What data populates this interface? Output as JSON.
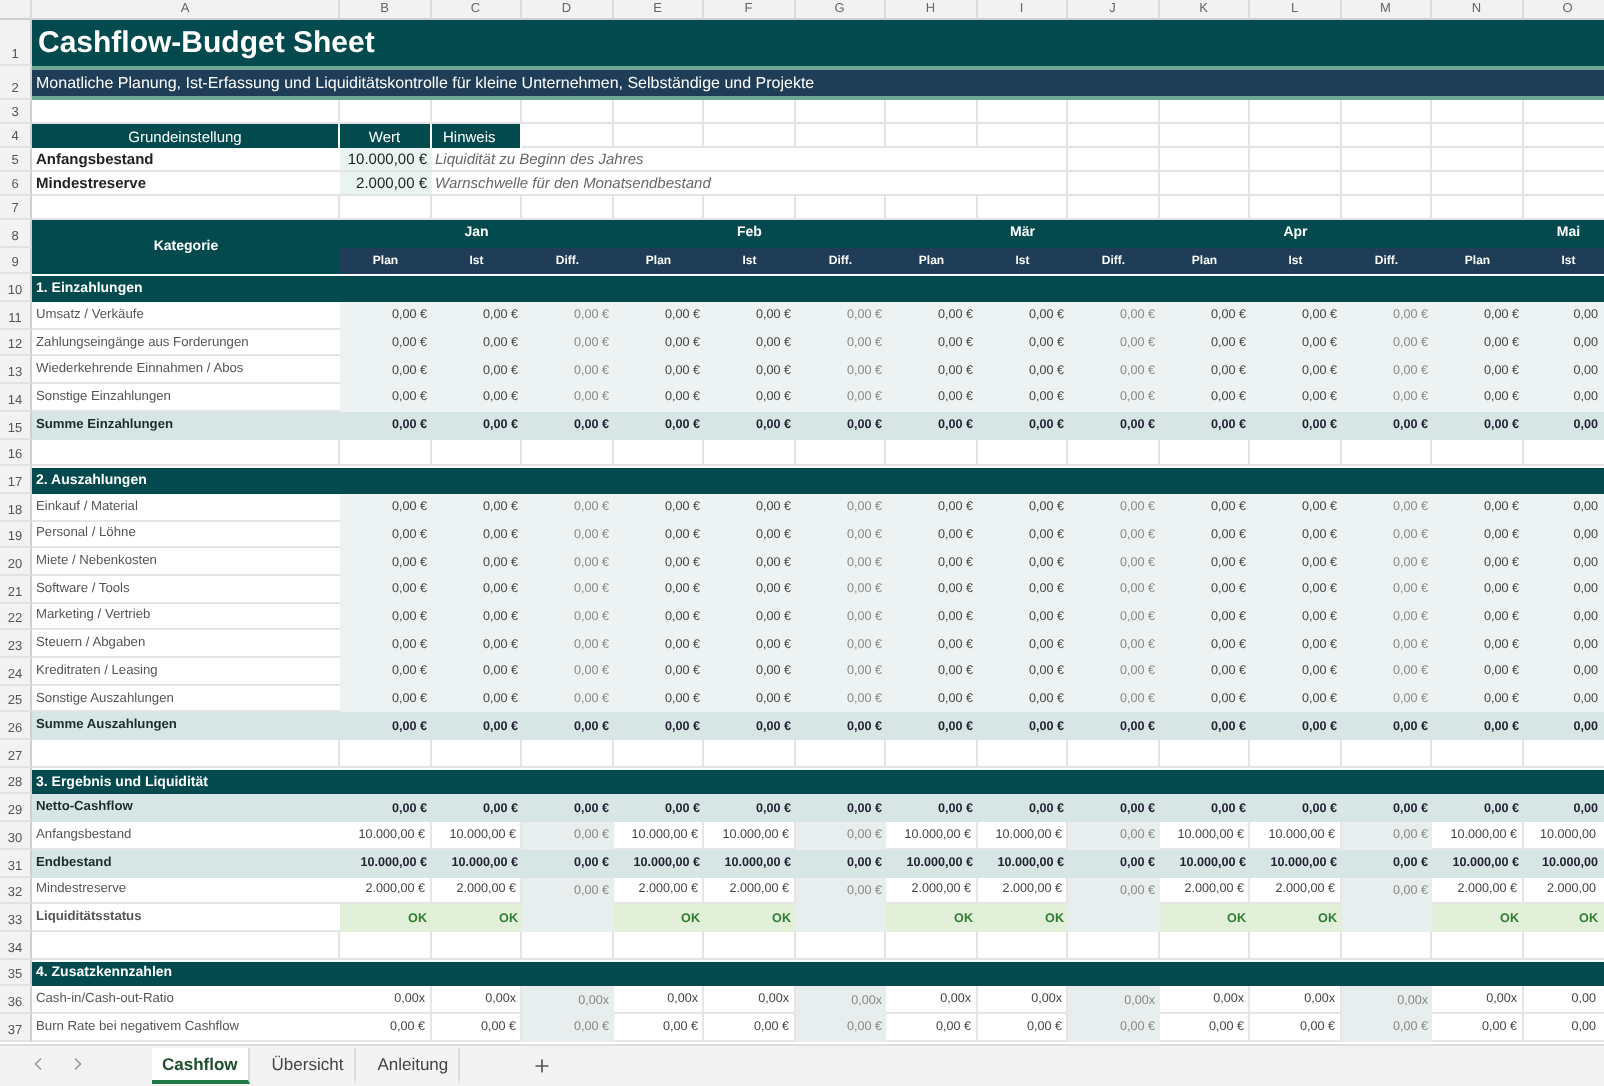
{
  "column_headers": [
    "A",
    "B",
    "C",
    "D",
    "E",
    "F",
    "G",
    "H",
    "I",
    "J",
    "K",
    "L",
    "M",
    "N",
    "O"
  ],
  "rows": [
    {
      "num": "1",
      "kind": "title",
      "text": "Cashflow-Budget Sheet"
    },
    {
      "num": "2",
      "kind": "subtitle",
      "text": "Monatliche Planung, Ist-Erfassung und Liquiditätskontrolle für kleine Unternehmen, Selbständige und Projekte"
    },
    {
      "num": "3",
      "kind": "blank"
    },
    {
      "num": "4",
      "kind": "settings_header",
      "cells": [
        "Grundeinstellung",
        "Wert",
        "Hinweis"
      ]
    },
    {
      "num": "5",
      "kind": "setting",
      "label": "Anfangsbestand",
      "value": "10.000,00 €",
      "hint": "Liquidität zu Beginn des Jahres"
    },
    {
      "num": "6",
      "kind": "setting",
      "label": "Mindestreserve",
      "value": "2.000,00 €",
      "hint": "Warnschwelle für den Monatsendbestand"
    },
    {
      "num": "7",
      "kind": "blank"
    },
    {
      "num": "8",
      "sub_num": "9",
      "kind": "table_header",
      "label": "Kategorie",
      "months": [
        "Jan",
        "Feb",
        "Mär",
        "Apr",
        "Mai"
      ],
      "subheads": [
        "Plan",
        "Ist",
        "Diff.",
        "Plan",
        "Ist",
        "Diff.",
        "Plan",
        "Ist",
        "Diff.",
        "Plan",
        "Ist",
        "Diff.",
        "Plan",
        "Ist"
      ]
    },
    {
      "num": "10",
      "kind": "section",
      "label": "1. Einzahlungen"
    },
    {
      "num": "11",
      "kind": "item",
      "label": "Umsatz / Verkäufe",
      "cells": [
        "0,00 €",
        "0,00 €",
        "0,00 €",
        "0,00 €",
        "0,00 €",
        "0,00 €",
        "0,00 €",
        "0,00 €",
        "0,00 €",
        "0,00 €",
        "0,00 €",
        "0,00 €",
        "0,00 €",
        "0,00"
      ]
    },
    {
      "num": "12",
      "kind": "item",
      "label": "Zahlungseingänge aus Forderungen",
      "cells": [
        "0,00 €",
        "0,00 €",
        "0,00 €",
        "0,00 €",
        "0,00 €",
        "0,00 €",
        "0,00 €",
        "0,00 €",
        "0,00 €",
        "0,00 €",
        "0,00 €",
        "0,00 €",
        "0,00 €",
        "0,00"
      ]
    },
    {
      "num": "13",
      "kind": "item",
      "label": "Wiederkehrende Einnahmen / Abos",
      "cells": [
        "0,00 €",
        "0,00 €",
        "0,00 €",
        "0,00 €",
        "0,00 €",
        "0,00 €",
        "0,00 €",
        "0,00 €",
        "0,00 €",
        "0,00 €",
        "0,00 €",
        "0,00 €",
        "0,00 €",
        "0,00"
      ]
    },
    {
      "num": "14",
      "kind": "item",
      "label": "Sonstige Einzahlungen",
      "cells": [
        "0,00 €",
        "0,00 €",
        "0,00 €",
        "0,00 €",
        "0,00 €",
        "0,00 €",
        "0,00 €",
        "0,00 €",
        "0,00 €",
        "0,00 €",
        "0,00 €",
        "0,00 €",
        "0,00 €",
        "0,00"
      ]
    },
    {
      "num": "15",
      "kind": "sum",
      "label": "Summe Einzahlungen",
      "cells": [
        "0,00 €",
        "0,00 €",
        "0,00 €",
        "0,00 €",
        "0,00 €",
        "0,00 €",
        "0,00 €",
        "0,00 €",
        "0,00 €",
        "0,00 €",
        "0,00 €",
        "0,00 €",
        "0,00 €",
        "0,00"
      ]
    },
    {
      "num": "16",
      "kind": "blank"
    },
    {
      "num": "17",
      "kind": "section",
      "label": "2. Auszahlungen"
    },
    {
      "num": "18",
      "kind": "item",
      "label": "Einkauf / Material",
      "cells": [
        "0,00 €",
        "0,00 €",
        "0,00 €",
        "0,00 €",
        "0,00 €",
        "0,00 €",
        "0,00 €",
        "0,00 €",
        "0,00 €",
        "0,00 €",
        "0,00 €",
        "0,00 €",
        "0,00 €",
        "0,00"
      ]
    },
    {
      "num": "19",
      "kind": "item",
      "label": "Personal / Löhne",
      "cells": [
        "0,00 €",
        "0,00 €",
        "0,00 €",
        "0,00 €",
        "0,00 €",
        "0,00 €",
        "0,00 €",
        "0,00 €",
        "0,00 €",
        "0,00 €",
        "0,00 €",
        "0,00 €",
        "0,00 €",
        "0,00"
      ]
    },
    {
      "num": "20",
      "kind": "item",
      "label": "Miete / Nebenkosten",
      "cells": [
        "0,00 €",
        "0,00 €",
        "0,00 €",
        "0,00 €",
        "0,00 €",
        "0,00 €",
        "0,00 €",
        "0,00 €",
        "0,00 €",
        "0,00 €",
        "0,00 €",
        "0,00 €",
        "0,00 €",
        "0,00"
      ]
    },
    {
      "num": "21",
      "kind": "item",
      "label": "Software / Tools",
      "cells": [
        "0,00 €",
        "0,00 €",
        "0,00 €",
        "0,00 €",
        "0,00 €",
        "0,00 €",
        "0,00 €",
        "0,00 €",
        "0,00 €",
        "0,00 €",
        "0,00 €",
        "0,00 €",
        "0,00 €",
        "0,00"
      ]
    },
    {
      "num": "22",
      "kind": "item",
      "label": "Marketing / Vertrieb",
      "cells": [
        "0,00 €",
        "0,00 €",
        "0,00 €",
        "0,00 €",
        "0,00 €",
        "0,00 €",
        "0,00 €",
        "0,00 €",
        "0,00 €",
        "0,00 €",
        "0,00 €",
        "0,00 €",
        "0,00 €",
        "0,00"
      ]
    },
    {
      "num": "23",
      "kind": "item",
      "label": "Steuern / Abgaben",
      "cells": [
        "0,00 €",
        "0,00 €",
        "0,00 €",
        "0,00 €",
        "0,00 €",
        "0,00 €",
        "0,00 €",
        "0,00 €",
        "0,00 €",
        "0,00 €",
        "0,00 €",
        "0,00 €",
        "0,00 €",
        "0,00"
      ]
    },
    {
      "num": "24",
      "kind": "item",
      "label": "Kreditraten / Leasing",
      "cells": [
        "0,00 €",
        "0,00 €",
        "0,00 €",
        "0,00 €",
        "0,00 €",
        "0,00 €",
        "0,00 €",
        "0,00 €",
        "0,00 €",
        "0,00 €",
        "0,00 €",
        "0,00 €",
        "0,00 €",
        "0,00"
      ]
    },
    {
      "num": "25",
      "kind": "item",
      "label": "Sonstige Auszahlungen",
      "cells": [
        "0,00 €",
        "0,00 €",
        "0,00 €",
        "0,00 €",
        "0,00 €",
        "0,00 €",
        "0,00 €",
        "0,00 €",
        "0,00 €",
        "0,00 €",
        "0,00 €",
        "0,00 €",
        "0,00 €",
        "0,00"
      ]
    },
    {
      "num": "26",
      "kind": "sum",
      "label": "Summe Auszahlungen",
      "cells": [
        "0,00 €",
        "0,00 €",
        "0,00 €",
        "0,00 €",
        "0,00 €",
        "0,00 €",
        "0,00 €",
        "0,00 €",
        "0,00 €",
        "0,00 €",
        "0,00 €",
        "0,00 €",
        "0,00 €",
        "0,00"
      ]
    },
    {
      "num": "27",
      "kind": "blank"
    },
    {
      "num": "28",
      "kind": "section",
      "label": "3. Ergebnis und Liquidität"
    },
    {
      "num": "29",
      "kind": "sum",
      "label": "Netto-Cashflow",
      "cells": [
        "0,00 €",
        "0,00 €",
        "0,00 €",
        "0,00 €",
        "0,00 €",
        "0,00 €",
        "0,00 €",
        "0,00 €",
        "0,00 €",
        "0,00 €",
        "0,00 €",
        "0,00 €",
        "0,00 €",
        "0,00"
      ]
    },
    {
      "num": "30",
      "kind": "result",
      "label": "Anfangsbestand",
      "cells": [
        "10.000,00 €",
        "10.000,00 €",
        "0,00 €",
        "10.000,00 €",
        "10.000,00 €",
        "0,00 €",
        "10.000,00 €",
        "10.000,00 €",
        "0,00 €",
        "10.000,00 €",
        "10.000,00 €",
        "0,00 €",
        "10.000,00 €",
        "10.000,00"
      ]
    },
    {
      "num": "31",
      "kind": "sum",
      "label": "Endbestand",
      "cells": [
        "10.000,00 €",
        "10.000,00 €",
        "0,00 €",
        "10.000,00 €",
        "10.000,00 €",
        "0,00 €",
        "10.000,00 €",
        "10.000,00 €",
        "0,00 €",
        "10.000,00 €",
        "10.000,00 €",
        "0,00 €",
        "10.000,00 €",
        "10.000,00"
      ]
    },
    {
      "num": "32",
      "kind": "result",
      "label": "Mindestreserve",
      "cells": [
        "2.000,00 €",
        "2.000,00 €",
        "0,00 €",
        "2.000,00 €",
        "2.000,00 €",
        "0,00 €",
        "2.000,00 €",
        "2.000,00 €",
        "0,00 €",
        "2.000,00 €",
        "2.000,00 €",
        "0,00 €",
        "2.000,00 €",
        "2.000,00"
      ]
    },
    {
      "num": "33",
      "kind": "status",
      "label": "Liquiditätsstatus",
      "cells": [
        "OK",
        "OK",
        null,
        "OK",
        "OK",
        null,
        "OK",
        "OK",
        null,
        "OK",
        "OK",
        null,
        "OK",
        "OK"
      ]
    },
    {
      "num": "34",
      "kind": "blank"
    },
    {
      "num": "35",
      "kind": "section",
      "label": "4. Zusatzkennzahlen"
    },
    {
      "num": "36",
      "kind": "result",
      "label": "Cash-in/Cash-out-Ratio",
      "cells": [
        "0,00x",
        "0,00x",
        "0,00x",
        "0,00x",
        "0,00x",
        "0,00x",
        "0,00x",
        "0,00x",
        "0,00x",
        "0,00x",
        "0,00x",
        "0,00x",
        "0,00x",
        "0,00"
      ]
    },
    {
      "num": "37",
      "kind": "result",
      "label": "Burn Rate bei negativem Cashflow",
      "cells": [
        "0,00 €",
        "0,00 €",
        "0,00 €",
        "0,00 €",
        "0,00 €",
        "0,00 €",
        "0,00 €",
        "0,00 €",
        "0,00 €",
        "0,00 €",
        "0,00 €",
        "0,00 €",
        "0,00 €",
        "0,00"
      ]
    }
  ],
  "sheet_tabs": [
    {
      "label": "Cashflow",
      "selected": true
    },
    {
      "label": "Übersicht",
      "selected": false
    },
    {
      "label": "Anleitung",
      "selected": false
    }
  ]
}
